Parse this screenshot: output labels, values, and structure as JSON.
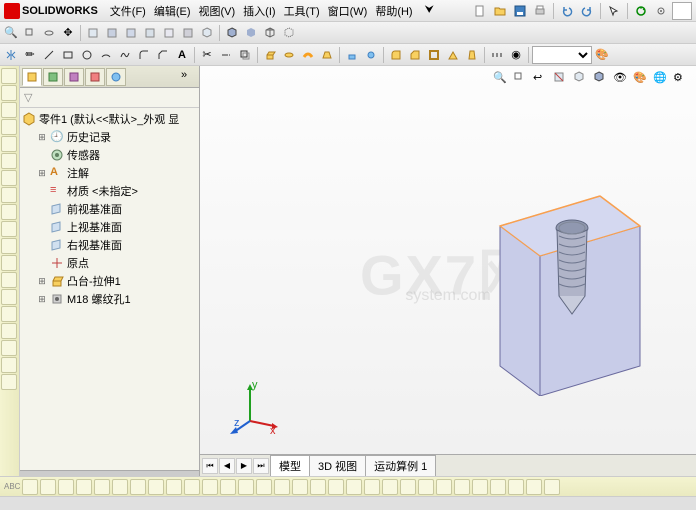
{
  "app": {
    "brand": "SOLIDWORKS"
  },
  "menu": {
    "file": "文件(F)",
    "edit": "编辑(E)",
    "view": "视图(V)",
    "insert": "插入(I)",
    "tools": "工具(T)",
    "window": "窗口(W)",
    "help": "帮助(H)"
  },
  "quick_access": {
    "new": "新建",
    "open": "打开",
    "save": "保存",
    "print": "打印",
    "undo": "撤销",
    "redo": "重做",
    "rebuild": "重建",
    "options": "选项",
    "search_placeholder": ""
  },
  "feature_tree": {
    "root": "零件1 (默认<<默认>_外观 显",
    "items": [
      {
        "label": "历史记录",
        "icon": "history-icon"
      },
      {
        "label": "传感器",
        "icon": "sensor-icon"
      },
      {
        "label": "注解",
        "icon": "annotation-icon",
        "expandable": true
      },
      {
        "label": "材质 <未指定>",
        "icon": "material-icon"
      },
      {
        "label": "前视基准面",
        "icon": "plane-icon"
      },
      {
        "label": "上视基准面",
        "icon": "plane-icon"
      },
      {
        "label": "右视基准面",
        "icon": "plane-icon"
      },
      {
        "label": "原点",
        "icon": "origin-icon"
      },
      {
        "label": "凸台-拉伸1",
        "icon": "extrude-icon",
        "expandable": true
      },
      {
        "label": "M18 螺纹孔1",
        "icon": "hole-icon",
        "expandable": true
      }
    ]
  },
  "view_tabs": {
    "model": "模型",
    "view3d": "3D 视图",
    "motion": "运动算例 1"
  },
  "triad": {
    "x": "x",
    "y": "y",
    "z": "z"
  },
  "watermark": {
    "main": "GX7网",
    "sub": "system.com"
  },
  "colors": {
    "part_face": "#c8cce8",
    "part_edge": "#6a6a9e",
    "part_highlight": "#f8c080",
    "thread": "#a0a0b0"
  }
}
